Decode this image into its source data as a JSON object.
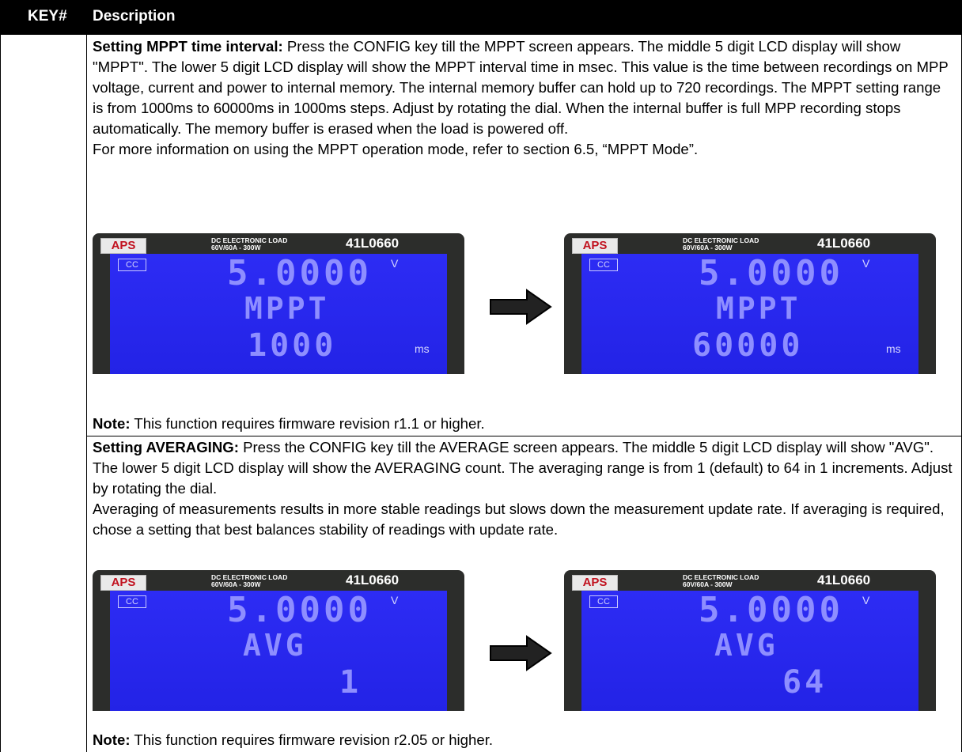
{
  "table": {
    "col_key": "KEY#",
    "col_desc": "Description"
  },
  "mppt": {
    "heading": "Setting MPPT time interval:",
    "body": " Press the CONFIG key till the MPPT screen appears. The middle 5 digit LCD display will show \"MPPT\". The lower 5 digit LCD display will show the MPPT interval time in msec. This value is the time between recordings on MPP voltage, current and power to internal memory. The internal memory buffer can hold up to 720 recordings. The MPPT setting range is from 1000ms to 60000ms in 1000ms steps. Adjust by rotating the dial. When the internal buffer is full MPP recording stops automatically. The memory buffer is erased when the load is powered off.",
    "ref": "For more information on using the MPPT operation mode, refer to section 6.5, “MPPT Mode”.",
    "note_label": "Note:",
    "note_text": " This function requires firmware revision r1.1 or higher.",
    "panel_left": {
      "top": "5.0000",
      "mid": "MPPT",
      "low": "1000",
      "unit": "ms"
    },
    "panel_right": {
      "top": "5.0000",
      "mid": "MPPT",
      "low": "60000",
      "unit": "ms"
    }
  },
  "avg": {
    "heading": "Setting AVERAGING:",
    "body": " Press the CONFIG key till the AVERAGE screen appears. The middle 5 digit LCD display will show \"AVG\". The lower 5 digit LCD display will show the AVERAGING count. The averaging range is from 1 (default) to 64 in 1 increments. Adjust by rotating the dial.",
    "body2": "Averaging of measurements results in more stable readings but slows down the measurement update rate.  If averaging is required, chose a setting that best balances stability of readings with update rate.",
    "note_label": "Note:",
    "note_text": " This function requires firmware revision r2.05 or higher.",
    "panel_left": {
      "top": "5.0000",
      "mid": "AVG",
      "low": "1"
    },
    "panel_right": {
      "top": "5.0000",
      "mid": "AVG",
      "low": "64"
    }
  },
  "device": {
    "brand": "APS",
    "model_line1": "DC ELECTRONIC LOAD",
    "model_line2": "60V/60A - 300W",
    "model_no": "41L0660",
    "mode": "CC",
    "volt_unit": "V"
  },
  "colors": {
    "lcd_blue": "#2727ea",
    "segment": "#8e8eff",
    "bezel": "#2c2d2b",
    "brand_red": "#c1121f"
  }
}
